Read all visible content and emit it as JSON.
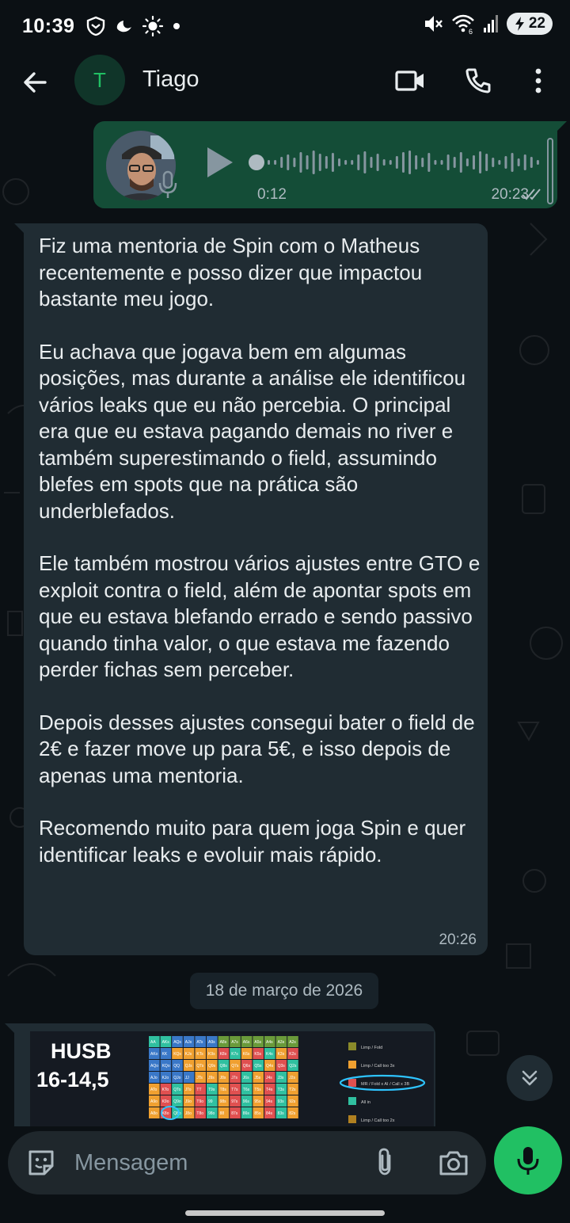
{
  "status_bar": {
    "time": "10:39",
    "battery": "22",
    "icons": [
      "shield-icon",
      "moon-icon",
      "sun-icon",
      "dot-icon",
      "mute-icon",
      "wifi-icon",
      "signal-icon",
      "battery-icon"
    ]
  },
  "header": {
    "avatar_letter": "T",
    "contact_name": "Tiago",
    "icons": [
      "back-arrow-icon",
      "video-call-icon",
      "phone-icon",
      "more-vert-icon"
    ]
  },
  "messages": {
    "voice": {
      "duration": "0:12",
      "time": "20:23",
      "status": "read",
      "waveform": [
        6,
        6,
        14,
        20,
        12,
        26,
        18,
        30,
        22,
        16,
        24,
        10,
        6,
        6,
        20,
        28,
        14,
        22,
        8,
        6,
        16,
        26,
        30,
        18,
        12,
        24,
        6,
        6,
        20,
        14,
        26,
        10,
        18,
        28,
        22,
        12,
        6,
        16,
        24,
        10,
        20,
        14,
        6
      ]
    },
    "text": {
      "paragraphs": [
        "Fiz uma mentoria de Spin com o Matheus recentemente e posso dizer que impactou bastante meu jogo.",
        "Eu achava que jogava bem em algumas posições, mas durante a análise ele identificou vários leaks que eu não percebia. O principal era que eu estava pagando demais no river e também superestimando o field, assumindo blefes em spots que na prática são underblefados.",
        "Ele também mostrou vários ajustes entre GTO e exploit contra o field, além de apontar spots em que eu estava blefando errado e sendo passivo quando tinha valor, o que estava me fazendo perder fichas sem perceber.",
        "Depois desses ajustes consegui bater o field de 2€ e fazer move up para 5€, e isso depois de apenas uma mentoria.",
        "Recomendo muito para quem joga Spin e quer identificar leaks e evoluir mais rápido."
      ],
      "time": "20:26"
    },
    "date_divider": "18 de março de 2026",
    "image": {
      "title_line1": "HUSB",
      "title_line2": "16-14,5",
      "grid_row_labels": [
        [
          "AA",
          "AKs",
          "AQs",
          "AJs",
          "ATs",
          "A9s",
          "A8s",
          "A7s",
          "A6s",
          "A5s",
          "A4s",
          "A3s",
          "A2s"
        ],
        [
          "AKo",
          "KK",
          "KQs",
          "KJs",
          "KTs",
          "K9s",
          "K8s",
          "K7s",
          "K6s",
          "K5s",
          "K4s",
          "K3s",
          "K2s"
        ],
        [
          "AQo",
          "KQo",
          "QQ",
          "QJs",
          "QTs",
          "Q9s",
          "Q8s",
          "Q7s",
          "Q6s",
          "Q5s",
          "Q4s",
          "Q3s",
          "Q2s"
        ],
        [
          "AJo",
          "KJo",
          "QJo",
          "JJ",
          "JTs",
          "J9s",
          "J8s",
          "J7s",
          "J6s",
          "J5s",
          "J4s",
          "J3s",
          "J2s"
        ],
        [
          "ATo",
          "KTo",
          "QTo",
          "JTo",
          "TT",
          "T9s",
          "T8s",
          "T7s",
          "T6s",
          "T5s",
          "T4s",
          "T3s",
          "T2s"
        ],
        [
          "A9o",
          "K9o",
          "Q9o",
          "J9o",
          "T9o",
          "99",
          "98s",
          "97s",
          "96s",
          "95s",
          "94s",
          "93s",
          "92s"
        ],
        [
          "A8o",
          "K8o",
          "Q8o",
          "J8o",
          "T8o",
          "98o",
          "88",
          "87s",
          "86s",
          "85s",
          "84s",
          "83s",
          "82s"
        ]
      ],
      "legend": [
        {
          "label": "Limp / Fold",
          "color": "#8a8a2a"
        },
        {
          "label": "Limp / Call too 3x",
          "color": "#f0a030"
        },
        {
          "label": "MR / Fold x AI / Call x 3B",
          "color": "#e05050"
        },
        {
          "label": "All in",
          "color": "#30c0a0"
        },
        {
          "label": "Limp / Call too 2x",
          "color": "#b08020"
        }
      ]
    }
  },
  "input": {
    "placeholder": "Mensagem",
    "value": ""
  },
  "colors": {
    "accent": "#21c063",
    "outgoing_bubble": "#144d37",
    "incoming_bubble": "#202c33",
    "background": "#0b1014",
    "highlight": "#2ec4ff"
  }
}
